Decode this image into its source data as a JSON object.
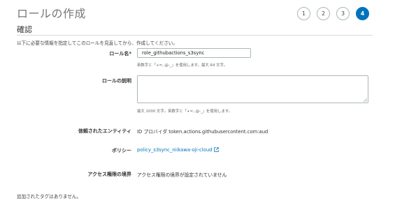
{
  "header": {
    "title": "ロールの作成",
    "steps": [
      "1",
      "2",
      "3",
      "4"
    ],
    "active_step": "4"
  },
  "section": {
    "heading": "確認",
    "intro": "以下に必要な情報を指定してこのロールを見直してから、作成してください。"
  },
  "role_name": {
    "label": "ロール名*",
    "value": "role_githubactions_s3sync",
    "hint": "英数字と「+=,.@-_」を使用します。最大 64 文字。"
  },
  "role_description": {
    "label": "ロールの説明",
    "value": "",
    "hint": "最大 1000 文字。英数字と「+=,.@-_」を使用します。"
  },
  "trusted_entity": {
    "label": "信頼されたエンティティ",
    "value": "ID プロバイダ token.actions.githubusercontent.com:aud"
  },
  "policy": {
    "label": "ポリシー",
    "link_text": "policy_s3sync_niikawa-oji-cloud",
    "icon": "external-link-icon"
  },
  "permissions_boundary": {
    "label": "アクセス権限の境界",
    "value": "アクセス権限の境界が設定されていません"
  },
  "tags_note": "追加されたタグはありません。",
  "colors": {
    "accent": "#0073bb",
    "border": "#aab7b8",
    "divider": "#d5dbdb"
  }
}
